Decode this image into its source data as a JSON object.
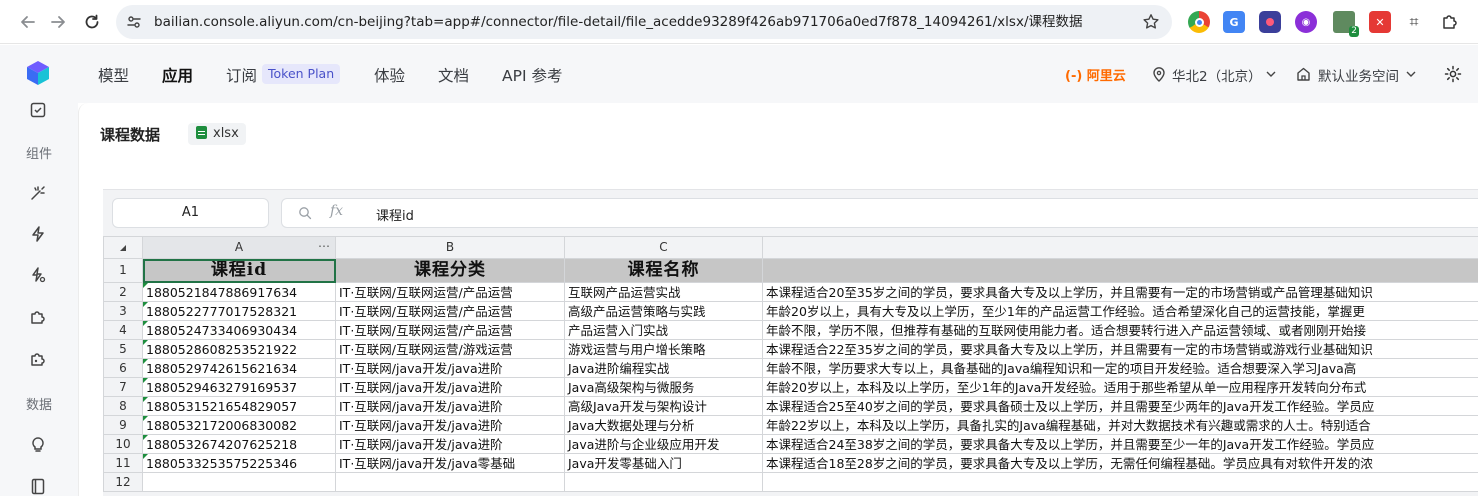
{
  "browser": {
    "url": "bailian.console.aliyun.com/cn-beijing?tab=app#/connector/file-detail/file_acedde93289f426ab971706a0ed7f878_14094261/xlsx/课程数据",
    "extension_badge": "2"
  },
  "rail": {
    "section_components": "组件",
    "section_data": "数据"
  },
  "topnav": {
    "items": [
      "模型",
      "应用",
      "订阅",
      "体验",
      "文档",
      "API 参考"
    ],
    "active": "应用",
    "subscribe_badge": "Token Plan",
    "brand": "(-) 阿里云",
    "region": "华北2（北京）",
    "workspace": "默认业务空间"
  },
  "file": {
    "title": "课程数据",
    "type_tag": "xlsx"
  },
  "sheet": {
    "name_box": "A1",
    "formula_value": "课程id",
    "columns": [
      "A",
      "B",
      "C"
    ],
    "header_row": [
      "课程id",
      "课程分类",
      "课程名称",
      ""
    ],
    "rows": [
      [
        "1880521847886917634",
        "IT·互联网/互联网运营/产品运营",
        "互联网产品运营实战",
        "本课程适合20至35岁之间的学员，要求具备大专及以上学历，并且需要有一定的市场营销或产品管理基础知识"
      ],
      [
        "1880522777017528321",
        "IT·互联网/互联网运营/产品运营",
        "高级产品运营策略与实践",
        "年龄20岁以上，具有大专及以上学历，至少1年的产品运营工作经验。适合希望深化自己的运营技能，掌握更"
      ],
      [
        "1880524733406930434",
        "IT·互联网/互联网运营/产品运营",
        "产品运营入门实战",
        "年龄不限，学历不限，但推荐有基础的互联网使用能力者。适合想要转行进入产品运营领域、或者刚刚开始接"
      ],
      [
        "1880528608253521922",
        "IT·互联网/互联网运营/游戏运营",
        "游戏运营与用户增长策略",
        "本课程适合22至35岁之间的学员，要求具备大专及以上学历，并且需要有一定的市场营销或游戏行业基础知识"
      ],
      [
        "1880529742615621634",
        "IT·互联网/java开发/java进阶",
        "Java进阶编程实战",
        "年龄不限，学历要求大专以上，具备基础的Java编程知识和一定的项目开发经验。适合想要深入学习Java高"
      ],
      [
        "1880529463279169537",
        "IT·互联网/java开发/java进阶",
        "Java高级架构与微服务",
        "年龄20岁以上，本科及以上学历，至少1年的Java开发经验。适用于那些希望从单一应用程序开发转向分布式"
      ],
      [
        "1880531521654829057",
        "IT·互联网/java开发/java进阶",
        "高级Java开发与架构设计",
        "本课程适合25至40岁之间的学员，要求具备硕士及以上学历，并且需要至少两年的Java开发工作经验。学员应"
      ],
      [
        "1880532172006830082",
        "IT·互联网/java开发/java进阶",
        "Java大数据处理与分析",
        "年龄22岁以上，本科及以上学历，具备扎实的Java编程基础，并对大数据技术有兴趣或需求的人士。特别适合"
      ],
      [
        "1880532674207625218",
        "IT·互联网/java开发/java进阶",
        "Java进阶与企业级应用开发",
        "本课程适合24至38岁之间的学员，要求具备大专及以上学历，并且需要至少一年的Java开发工作经验。学员应"
      ],
      [
        "1880533253575225346",
        "IT·互联网/java开发/java零基础",
        "Java开发零基础入门",
        "本课程适合18至28岁之间的学员，要求具备大专及以上学历，无需任何编程基础。学员应具有对软件开发的浓"
      ]
    ],
    "row_numbers": [
      "1",
      "2",
      "3",
      "4",
      "5",
      "6",
      "7",
      "8",
      "9",
      "10",
      "11",
      "12"
    ]
  }
}
